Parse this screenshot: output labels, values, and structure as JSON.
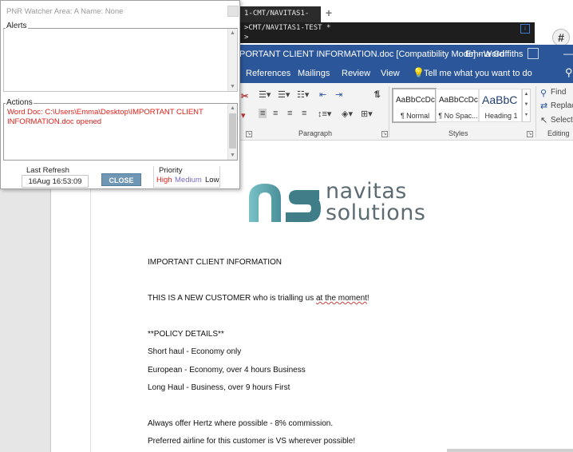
{
  "pnr_watcher": {
    "title": "PNR Watcher  Area: A  Name: None",
    "alerts_label": "Alerts",
    "actions_label": "Actions",
    "action_message": "Word Doc: C:\\Users\\Emma\\Desktop\\IMPORTANT CLIENT INFORMATION.doc opened",
    "last_refresh_label": "Last Refresh",
    "last_refresh_value": "16Aug 16:53:09",
    "close_label": "CLOSE",
    "priority_label": "Priority",
    "priority_levels": [
      "High",
      "Medium",
      "Low"
    ],
    "priority_colors": {
      "high": "#e0201a",
      "medium": "#7b68c8",
      "low": "#222222"
    }
  },
  "terminal": {
    "tab_label": "1-CMT/NAVITAS1-",
    "line1": ">CMT/NAVITAS1-TEST *",
    "line2": ">",
    "new_tab": "+",
    "hash_button": "#"
  },
  "word": {
    "title": "PORTANT CLIENT INFORMATION.doc [Compatibility Mode]  -  Word",
    "user": "Emma Griffiths",
    "tabs": [
      "References",
      "Mailings",
      "Review",
      "View"
    ],
    "tell_me": "Tell me what you want to do",
    "groups": {
      "paragraph": "Paragraph",
      "styles": "Styles",
      "editing": "Editing"
    },
    "styles": [
      {
        "sample": "AaBbCcDc",
        "name": "¶ Normal"
      },
      {
        "sample": "AaBbCcDc",
        "name": "¶ No Spac..."
      },
      {
        "sample": "AaBbC",
        "name": "Heading 1"
      }
    ],
    "editing": {
      "find": "Find",
      "replace": "Replac",
      "select": "Select"
    },
    "accent_color": "#2b579a"
  },
  "document": {
    "logo_line1": "navitas",
    "logo_line2": "solutions",
    "heading": "IMPORTANT CLIENT INFORMATION",
    "new_customer_prefix": "THIS IS A NEW CUSTOMER who is trialling us ",
    "new_customer_flagged": "at the moment",
    "new_customer_suffix": "!",
    "policy_heading": "**POLICY DETAILS**",
    "lines": [
      "Short haul - Economy only",
      "European - Economy, over 4 hours Business",
      "Long Haul - Business, over 9 hours First"
    ],
    "hertz": "Always offer Hertz where possible - 8% commission.",
    "airline": "Preferred airline for this customer is VS wherever possible!"
  }
}
